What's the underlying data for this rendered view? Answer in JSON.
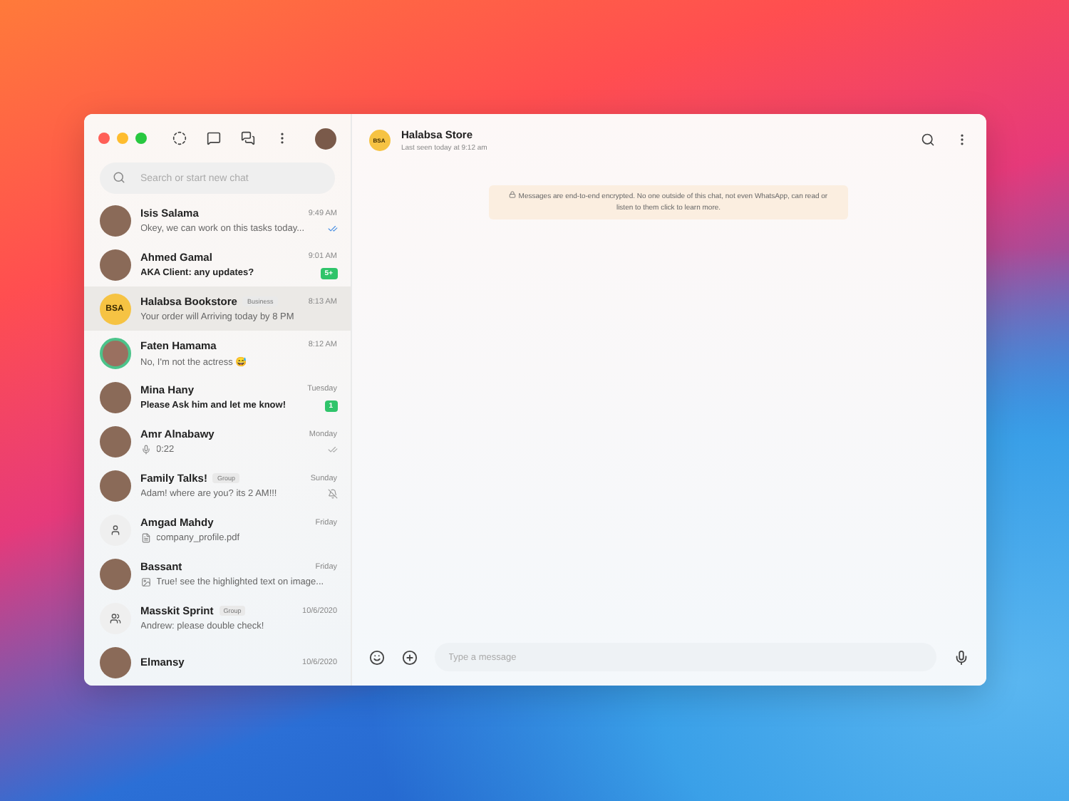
{
  "search": {
    "placeholder": "Search or start new chat"
  },
  "chats": [
    {
      "name": "Isis Salama",
      "time": "9:49 AM",
      "preview": "Okey, we can work on this tasks today...",
      "status": {
        "kind": "read"
      },
      "bold": false,
      "selected": false,
      "avatar": {
        "kind": "photo"
      }
    },
    {
      "name": "Ahmed Gamal",
      "time": "9:01 AM",
      "preview": "AKA Client: any updates?",
      "unread_badge": "5+",
      "bold": true,
      "selected": false,
      "avatar": {
        "kind": "photo"
      }
    },
    {
      "name": "Halabsa Bookstore",
      "tag": "Business",
      "time": "8:13 AM",
      "preview": "Your order will Arriving today by 8 PM",
      "bold": false,
      "selected": true,
      "avatar": {
        "kind": "logo",
        "text": "BSA"
      }
    },
    {
      "name": "Faten Hamama",
      "time": "8:12 AM",
      "preview": "No, I'm not the actress 😅",
      "bold": false,
      "selected": false,
      "avatar": {
        "kind": "ring"
      }
    },
    {
      "name": "Mina Hany",
      "time": "Tuesday",
      "preview": "Please Ask him and let me know!",
      "unread_badge": "1",
      "bold": true,
      "selected": false,
      "avatar": {
        "kind": "photo"
      }
    },
    {
      "name": "Amr Alnabawy",
      "time": "Monday",
      "preview": "0:22",
      "preview_icon": {
        "kind": "mic"
      },
      "status": {
        "kind": "delivered"
      },
      "bold": false,
      "selected": false,
      "avatar": {
        "kind": "photo"
      }
    },
    {
      "name": "Family Talks!",
      "tag": "Group",
      "time": "Sunday",
      "preview": "Adam! where are you? its 2 AM!!!",
      "status": {
        "kind": "muted"
      },
      "bold": false,
      "selected": false,
      "avatar": {
        "kind": "photo"
      }
    },
    {
      "name": "Amgad Mahdy",
      "time": "Friday",
      "preview": "company_profile.pdf",
      "preview_icon": {
        "kind": "document"
      },
      "bold": false,
      "selected": false,
      "avatar": {
        "kind": "person"
      }
    },
    {
      "name": "Bassant",
      "time": "Friday",
      "preview": "True! see the highlighted text on image...",
      "preview_icon": {
        "kind": "image"
      },
      "bold": false,
      "selected": false,
      "avatar": {
        "kind": "photo"
      }
    },
    {
      "name": "Masskit Sprint",
      "tag": "Group",
      "time": "10/6/2020",
      "preview": "Andrew: please double check!",
      "bold": false,
      "selected": false,
      "avatar": {
        "kind": "group"
      }
    },
    {
      "name": "Elmansy",
      "time": "10/6/2020",
      "selected": false,
      "avatar": {
        "kind": "photo"
      }
    }
  ],
  "conversation": {
    "title": "Halabsa Store",
    "subtitle": "Last seen today at 9:12 am",
    "avatar_text": "BSA",
    "notice": "Messages are end-to-end encrypted. No one outside of this chat, not even WhatsApp, can read or listen to them click to learn more.",
    "composer": {
      "placeholder": "Type a message"
    }
  }
}
